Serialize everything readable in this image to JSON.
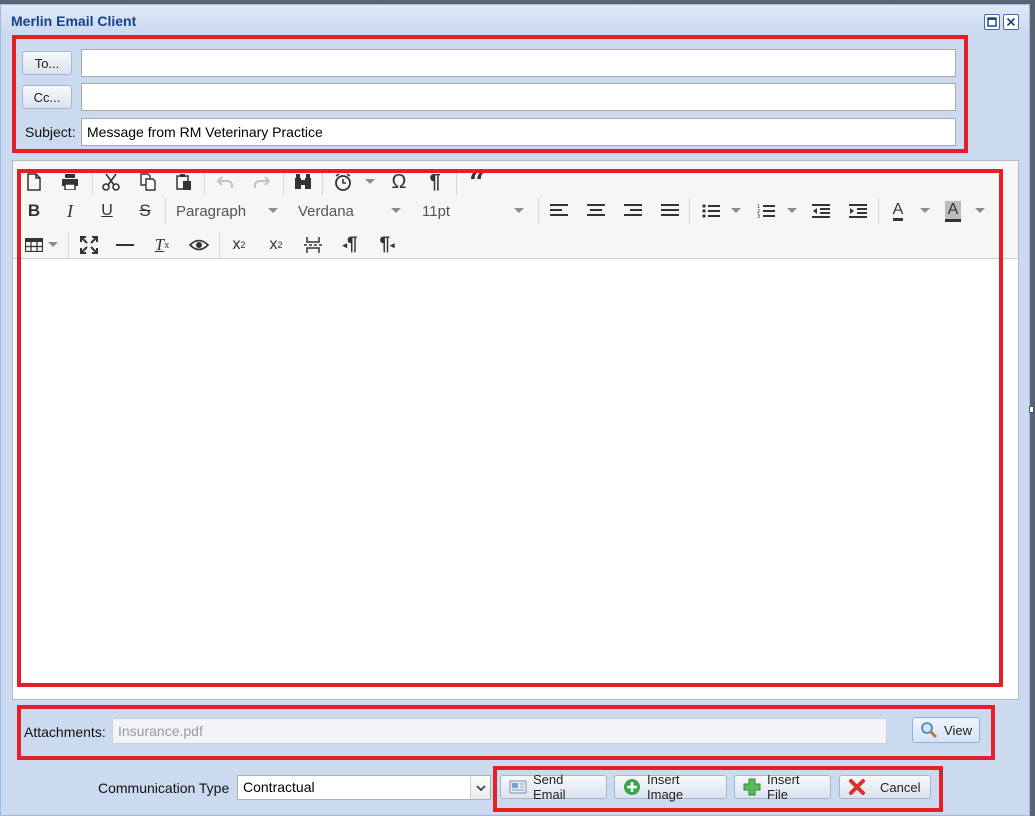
{
  "window": {
    "title": "Merlin Email Client",
    "maximize_icon": "maximize-icon",
    "close_icon": "close-icon"
  },
  "header": {
    "to_button": "To...",
    "to_value": "",
    "cc_button": "Cc...",
    "cc_value": "",
    "subject_label": "Subject:",
    "subject_value": "Message from RM Veterinary Practice"
  },
  "editor": {
    "toolbar_row1": [
      "new-document-icon",
      "print-icon",
      "cut-icon",
      "copy-icon",
      "paste-icon",
      "undo-icon",
      "redo-icon",
      "find-icon",
      "insert-datetime-icon",
      "special-char-icon",
      "show-blocks-icon",
      "blockquote-icon"
    ],
    "block_format": "Paragraph",
    "font_family": "Verdana",
    "font_size": "11pt",
    "toolbar_row3": [
      "table-icon",
      "fullscreen-icon",
      "horizontal-rule-icon",
      "clear-formatting-icon",
      "preview-icon",
      "subscript-icon",
      "superscript-icon",
      "page-break-icon",
      "ltr-icon",
      "rtl-icon"
    ],
    "body_text": ""
  },
  "attachments": {
    "label": "Attachments:",
    "value": "Insurance.pdf",
    "view_button": "View"
  },
  "footer": {
    "communication_type_label": "Communication Type",
    "communication_type_value": "Contractual",
    "send_email_button": "Send Email",
    "insert_image_button": "Insert Image",
    "insert_file_button": "Insert File",
    "cancel_button": "Cancel"
  },
  "colors": {
    "highlight_border": "#e3202a",
    "window_bg": "#ccdaf0",
    "title_color": "#15428b"
  }
}
